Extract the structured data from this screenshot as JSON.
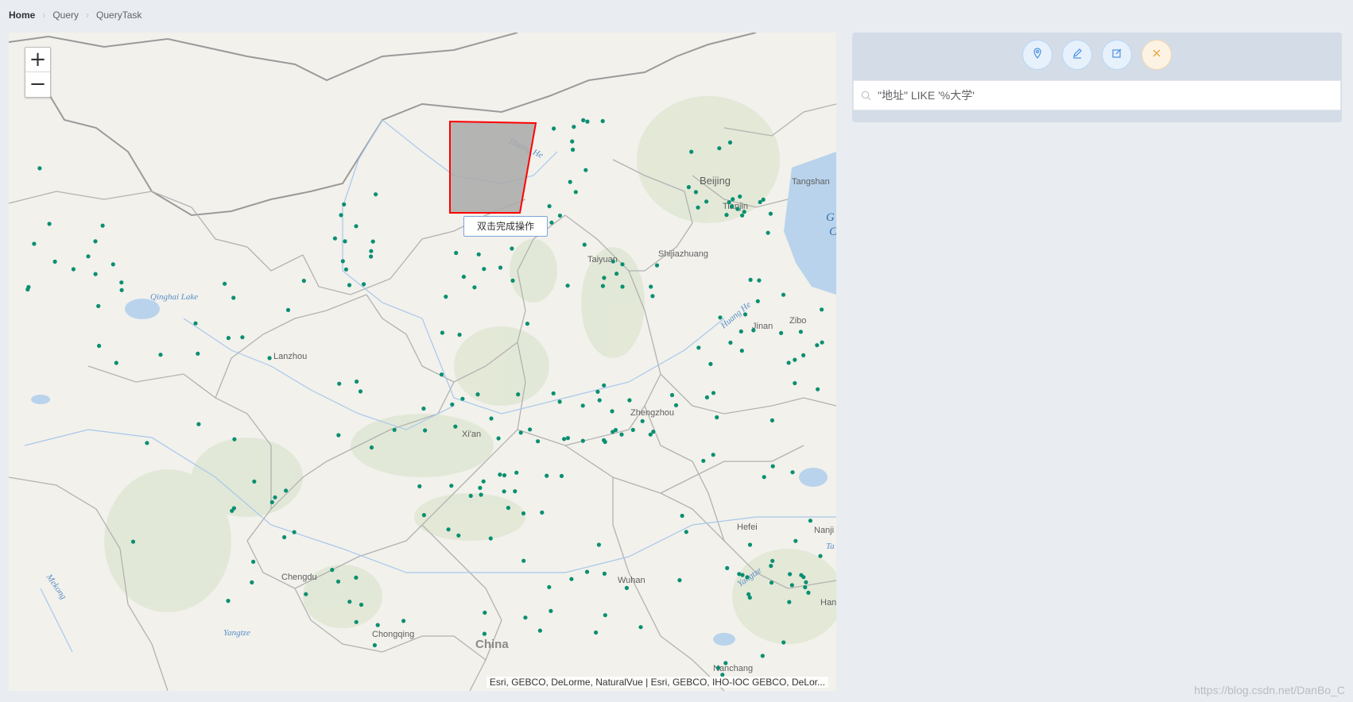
{
  "breadcrumb": [
    {
      "label": "Home"
    },
    {
      "label": "Query"
    },
    {
      "label": "QueryTask"
    }
  ],
  "map": {
    "zoom_in": "+",
    "zoom_out": "−",
    "tooltip": "双击完成操作",
    "attribution": "Esri, GEBCO, DeLorme, NaturalVue | Esri, GEBCO, IHO-IOC GEBCO, DeLor...",
    "labels": {
      "beijing": "Beijing",
      "tianjin": "Tianjin",
      "tangshan": "Tangshan",
      "shijiazhuang": "Shijiazhuang",
      "taiyuan": "Taiyuan",
      "jinan": "Jinan",
      "zibo": "Zibo",
      "zhengzhou": "Zhengzhou",
      "xian": "Xi'an",
      "lanzhou": "Lanzhou",
      "qinghai": "Qinghai Lake",
      "chengdu": "Chengdu",
      "chongqing": "Chongqing",
      "wuhan": "Wuhan",
      "hefei": "Hefei",
      "nanjing": "Nanji",
      "nanchang": "Nanchang",
      "china": "China",
      "huanghe1": "Huang He",
      "huanghe2": "Huang He",
      "yangtze1": "Yangtze",
      "yangtze2": "Yangtze",
      "mekong": "Mekong",
      "gulf": "G",
      "gulf2": "C",
      "han": "Han",
      "ta": "Ta"
    },
    "point_color": "#0a8f72",
    "polygon_stroke": "#ff0000",
    "polygon_fill": "#a9a9a9"
  },
  "panel": {
    "tools": [
      {
        "icon": "location-pin-icon"
      },
      {
        "icon": "pen-icon"
      },
      {
        "icon": "edit-icon"
      },
      {
        "icon": "close-icon"
      }
    ],
    "search_value": "\"地址\" LIKE '%大学'"
  },
  "watermark": "https://blog.csdn.net/DanBo_C"
}
